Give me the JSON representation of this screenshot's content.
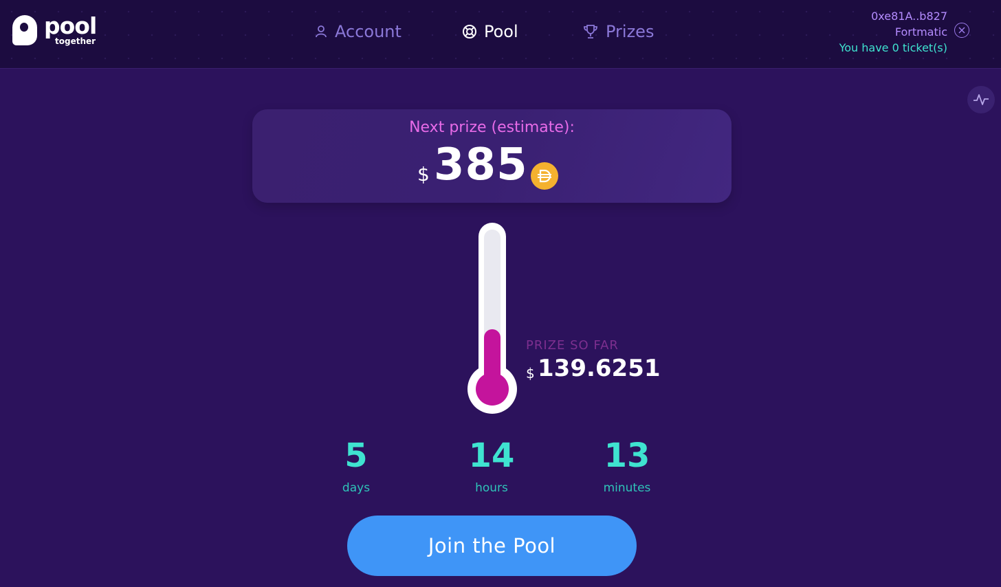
{
  "brand": {
    "logo_text": "pool",
    "logo_subtext": "together"
  },
  "nav": {
    "items": [
      {
        "label": "Account",
        "icon": "user-icon",
        "active": false
      },
      {
        "label": "Pool",
        "icon": "lifebuoy-icon",
        "active": true
      },
      {
        "label": "Prizes",
        "icon": "trophy-icon",
        "active": false
      }
    ]
  },
  "wallet": {
    "address": "0xe81A..b827",
    "provider": "Fortmatic",
    "tickets": "You have 0 ticket(s)"
  },
  "prize": {
    "label": "Next prize (estimate):",
    "currency": "$",
    "amount": "385",
    "token_icon": "dai-icon"
  },
  "progress": {
    "label": "PRIZE SO FAR",
    "currency": "$",
    "amount": "139.6251",
    "fill_fraction": 0.36
  },
  "countdown": [
    {
      "value": "5",
      "unit": "days"
    },
    {
      "value": "14",
      "unit": "hours"
    },
    {
      "value": "13",
      "unit": "minutes"
    }
  ],
  "cta": {
    "label": "Join the Pool"
  },
  "colors": {
    "background": "#2c125c",
    "header": "#1c0c40",
    "accent_teal": "#3fe3d0",
    "accent_pink": "#e86be8",
    "thermo_fill": "#c4149c",
    "button": "#3f95f7",
    "dai": "#f4b12f"
  }
}
